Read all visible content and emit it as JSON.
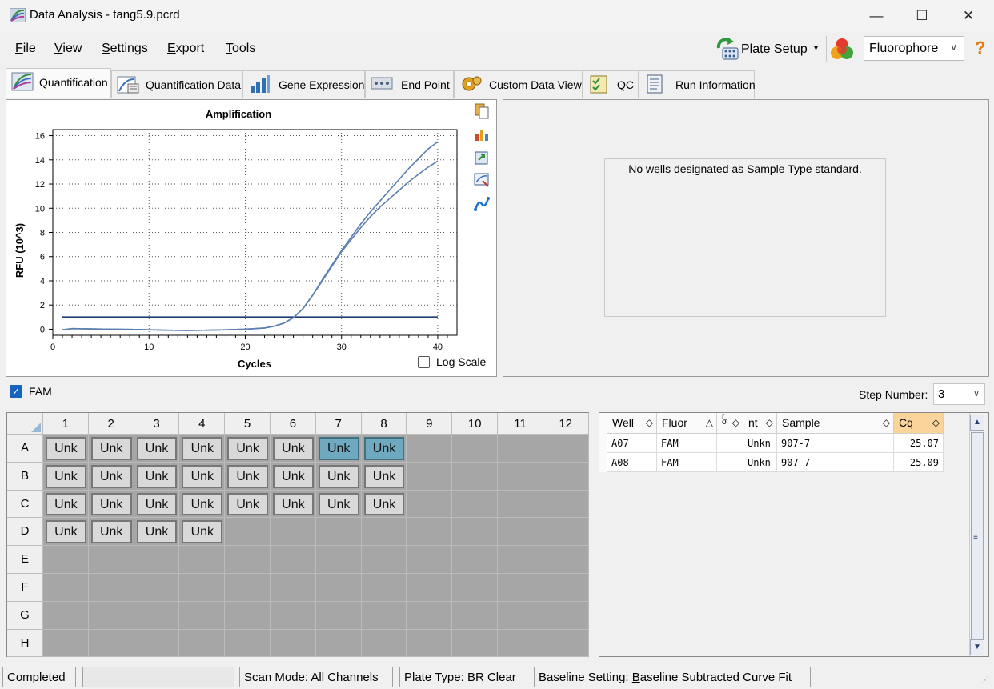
{
  "window": {
    "title": "Data Analysis - tang5.9.pcrd",
    "minimize": "—",
    "maximize": "☐",
    "close": "✕"
  },
  "menu": {
    "file": {
      "hot": "F",
      "rest": "ile"
    },
    "view": {
      "hot": "V",
      "rest": "iew"
    },
    "settings": {
      "hot": "S",
      "rest": "ettings"
    },
    "export": {
      "hot": "E",
      "rest": "xport"
    },
    "tools": {
      "hot": "T",
      "rest": "ools"
    }
  },
  "toolbar": {
    "plate_setup_hot": "P",
    "plate_setup_rest": "late Setup",
    "caret": "▾",
    "fluorophore_value": "Fluorophore",
    "dropdown_caret": "∨",
    "help": "?"
  },
  "tabs": [
    {
      "label": "Quantification",
      "icon": "amplification-curves-icon"
    },
    {
      "label": "Quantification Data",
      "icon": "quantification-data-icon"
    },
    {
      "label": "Gene Expression",
      "icon": "bar-chart-icon"
    },
    {
      "label": "End Point",
      "icon": "end-point-icon"
    },
    {
      "label": "Custom Data View",
      "icon": "gear-icon"
    },
    {
      "label": "QC",
      "icon": "checklist-icon"
    },
    {
      "label": "Run Information",
      "icon": "document-icon"
    }
  ],
  "std_curve": {
    "message": "No wells designated as Sample Type standard."
  },
  "fluor_filter": {
    "label": "FAM",
    "checked": true
  },
  "step": {
    "label": "Step Number:",
    "value": "3"
  },
  "plate": {
    "columns": [
      "1",
      "2",
      "3",
      "4",
      "5",
      "6",
      "7",
      "8",
      "9",
      "10",
      "11",
      "12"
    ],
    "rows": [
      "A",
      "B",
      "C",
      "D",
      "E",
      "F",
      "G",
      "H"
    ],
    "well_label": "Unk",
    "filled": [
      [
        "Unk",
        "Unk",
        "Unk",
        "Unk",
        "Unk",
        "Unk",
        "Unk",
        "Unk",
        "",
        "",
        "",
        ""
      ],
      [
        "Unk",
        "Unk",
        "Unk",
        "Unk",
        "Unk",
        "Unk",
        "Unk",
        "Unk",
        "",
        "",
        "",
        ""
      ],
      [
        "Unk",
        "Unk",
        "Unk",
        "Unk",
        "Unk",
        "Unk",
        "Unk",
        "Unk",
        "",
        "",
        "",
        ""
      ],
      [
        "Unk",
        "Unk",
        "Unk",
        "Unk",
        "",
        "",
        "",
        "",
        "",
        "",
        "",
        ""
      ],
      [
        "",
        "",
        "",
        "",
        "",
        "",
        "",
        "",
        "",
        "",
        "",
        ""
      ],
      [
        "",
        "",
        "",
        "",
        "",
        "",
        "",
        "",
        "",
        "",
        "",
        ""
      ],
      [
        "",
        "",
        "",
        "",
        "",
        "",
        "",
        "",
        "",
        "",
        "",
        ""
      ],
      [
        "",
        "",
        "",
        "",
        "",
        "",
        "",
        "",
        "",
        "",
        "",
        ""
      ]
    ],
    "selected": [
      "A7",
      "A8"
    ]
  },
  "well_table": {
    "headers": [
      "Well",
      "Fluor",
      "r\nσ",
      "nt",
      "Sample",
      "Cq"
    ],
    "sort_glyph": "◇",
    "sort_up": "△",
    "rows": [
      {
        "well": "A07",
        "fluor": "FAM",
        "target": "",
        "content": "Unkn",
        "sample": "907-7",
        "cq": "25.07"
      },
      {
        "well": "A08",
        "fluor": "FAM",
        "target": "",
        "content": "Unkn",
        "sample": "907-7",
        "cq": "25.09"
      }
    ]
  },
  "status": {
    "state": "Completed",
    "scan_mode": "Scan Mode: All Channels",
    "plate_type": "Plate Type: BR Clear",
    "baseline_prefix": "Baseline Setting: ",
    "baseline_hot": "B",
    "baseline_rest": "aseline Subtracted Curve Fit"
  },
  "chart_data": {
    "type": "line",
    "title": "Amplification",
    "xlabel": "Cycles",
    "ylabel": "RFU (10^3)",
    "xlim": [
      0,
      42
    ],
    "ylim": [
      -0.5,
      16.5
    ],
    "x_ticks": [
      0,
      10,
      20,
      30,
      40
    ],
    "y_ticks": [
      0,
      2,
      4,
      6,
      8,
      10,
      12,
      14,
      16
    ],
    "grid": true,
    "log_scale": false,
    "log_scale_label": "Log Scale",
    "threshold": 1.0,
    "threshold_x_range": [
      1,
      40
    ],
    "colors": {
      "curve": "#5b7fb0",
      "threshold": "#1c3f73",
      "grid": "#555555"
    },
    "series": [
      {
        "x": [
          1,
          2,
          4,
          6,
          8,
          10,
          12,
          14,
          16,
          18,
          20,
          22,
          23,
          24,
          25,
          26,
          27,
          28,
          29,
          30,
          31,
          32,
          33,
          34,
          35,
          36,
          37,
          38,
          39,
          40
        ],
        "values": [
          -0.05,
          0.05,
          0.02,
          0.0,
          -0.02,
          -0.05,
          -0.08,
          -0.1,
          -0.08,
          -0.05,
          0.0,
          0.1,
          0.25,
          0.5,
          0.95,
          1.7,
          2.8,
          4.1,
          5.3,
          6.5,
          7.6,
          8.7,
          9.7,
          10.6,
          11.5,
          12.4,
          13.3,
          14.1,
          14.9,
          15.5
        ]
      },
      {
        "x": [
          1,
          2,
          4,
          6,
          8,
          10,
          12,
          14,
          16,
          18,
          20,
          22,
          23,
          24,
          25,
          26,
          27,
          28,
          29,
          30,
          31,
          32,
          33,
          34,
          35,
          36,
          37,
          38,
          39,
          40
        ],
        "values": [
          -0.05,
          0.05,
          0.02,
          0.0,
          -0.02,
          -0.05,
          -0.08,
          -0.1,
          -0.08,
          -0.05,
          0.0,
          0.1,
          0.25,
          0.5,
          0.95,
          1.7,
          2.8,
          4.0,
          5.2,
          6.4,
          7.4,
          8.4,
          9.3,
          10.1,
          10.8,
          11.5,
          12.2,
          12.8,
          13.4,
          13.9
        ]
      }
    ]
  }
}
